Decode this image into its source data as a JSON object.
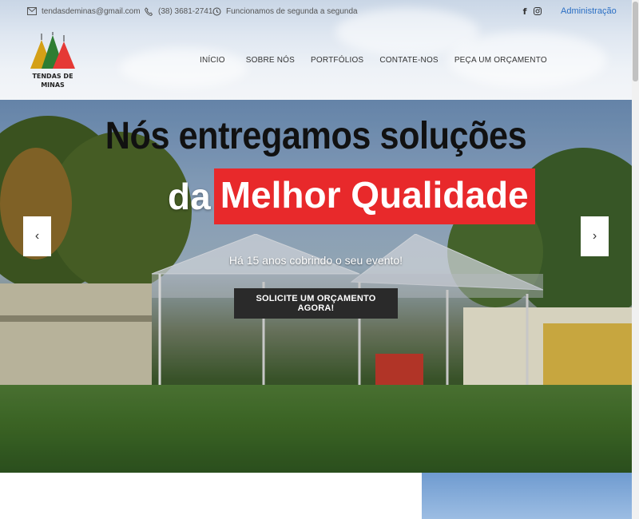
{
  "topbar": {
    "email": "tendasdeminas@gmail.com",
    "phone": "(38) 3681-2741",
    "hours": "Funcionamos de segunda a segunda",
    "admin_label": "Administração",
    "icons": [
      "envelope-icon",
      "phone-icon",
      "clock-icon",
      "facebook-icon",
      "instagram-icon"
    ]
  },
  "logo": {
    "text_line1": "TENDAS DE",
    "text_line2": "MINAS",
    "colors": [
      "#d4a017",
      "#2e7d32",
      "#e53935"
    ]
  },
  "nav": {
    "items": [
      {
        "label": "INÍCIO"
      },
      {
        "label": "SOBRE NÓS"
      },
      {
        "label": "PORTFÓLIOS"
      },
      {
        "label": "CONTATE-NOS"
      },
      {
        "label": "PEÇA UM ORÇAMENTO"
      }
    ]
  },
  "hero": {
    "headline_line1": "Nós entregamos soluções",
    "headline_line2_plain": "da",
    "headline_line2_highlight": "Melhor Qualidade",
    "subtext": "Há 15 anos cobrindo o seu evento!",
    "cta_label": "SOLICITE UM ORÇAMENTO AGORA!",
    "prev_arrow": "‹",
    "next_arrow": "›",
    "highlight_color": "#e8292b"
  }
}
